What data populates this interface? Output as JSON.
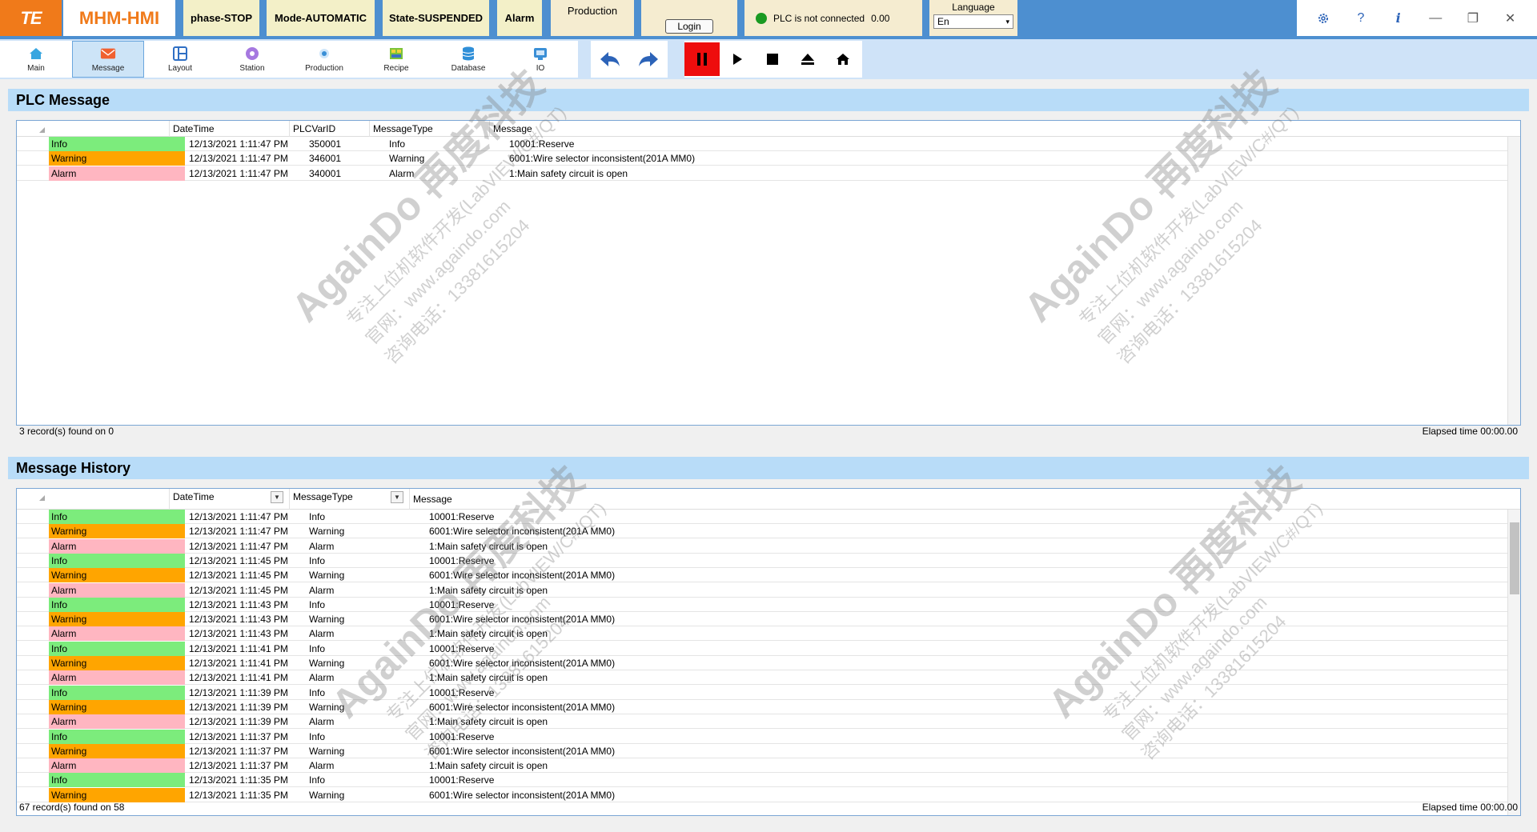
{
  "titlebar": {
    "logo": "TE",
    "app_title": "MHM-HMI",
    "phase": "phase-STOP",
    "mode": "Mode-AUTOMATIC",
    "state": "State-SUSPENDED",
    "alarm": "Alarm",
    "production": "Production",
    "login": "Login",
    "plc_status": "PLC is not connected",
    "plc_value": "0.00",
    "language_label": "Language",
    "language_value": "En"
  },
  "toolbar": {
    "nav": [
      {
        "label": "Main",
        "icon": "home-icon"
      },
      {
        "label": "Message",
        "icon": "mail-icon"
      },
      {
        "label": "Layout",
        "icon": "layout-icon"
      },
      {
        "label": "Station",
        "icon": "station-icon"
      },
      {
        "label": "Production",
        "icon": "production-icon"
      },
      {
        "label": "Recipe",
        "icon": "recipe-icon"
      },
      {
        "label": "Database",
        "icon": "database-icon"
      },
      {
        "label": "IO",
        "icon": "io-icon"
      }
    ],
    "active_tab": "Message"
  },
  "colors": {
    "accent": "#4d8fd0",
    "info": "#7cec7c",
    "warning": "#ffa500",
    "alarm": "#ffb6c1",
    "pause": "#ee0d0d",
    "logo": "#f07a1a"
  },
  "plc_message": {
    "title": "PLC Message",
    "columns": [
      "DateTime",
      "PLCVarID",
      "MessageType",
      "Message"
    ],
    "rows": [
      {
        "type": "Info",
        "datetime": "12/13/2021 1:11:47 PM",
        "varid": "350001",
        "mtype": "Info",
        "message": "10001:Reserve"
      },
      {
        "type": "Warning",
        "datetime": "12/13/2021 1:11:47 PM",
        "varid": "346001",
        "mtype": "Warning",
        "message": "6001:Wire selector inconsistent(201A MM0)"
      },
      {
        "type": "Alarm",
        "datetime": "12/13/2021 1:11:47 PM",
        "varid": "340001",
        "mtype": "Alarm",
        "message": "1:Main safety circuit is open"
      }
    ],
    "footer_left": "3 record(s) found on 0",
    "footer_right": "Elapsed time 00:00.00"
  },
  "message_history": {
    "title": "Message History",
    "columns": [
      "DateTime",
      "MessageType",
      "Message"
    ],
    "rows": [
      {
        "type": "Info",
        "datetime": "12/13/2021 1:11:47 PM",
        "mtype": "Info",
        "message": "10001:Reserve"
      },
      {
        "type": "Warning",
        "datetime": "12/13/2021 1:11:47 PM",
        "mtype": "Warning",
        "message": "6001:Wire selector inconsistent(201A MM0)"
      },
      {
        "type": "Alarm",
        "datetime": "12/13/2021 1:11:47 PM",
        "mtype": "Alarm",
        "message": "1:Main safety circuit is open"
      },
      {
        "type": "Info",
        "datetime": "12/13/2021 1:11:45 PM",
        "mtype": "Info",
        "message": "10001:Reserve"
      },
      {
        "type": "Warning",
        "datetime": "12/13/2021 1:11:45 PM",
        "mtype": "Warning",
        "message": "6001:Wire selector inconsistent(201A MM0)"
      },
      {
        "type": "Alarm",
        "datetime": "12/13/2021 1:11:45 PM",
        "mtype": "Alarm",
        "message": "1:Main safety circuit is open"
      },
      {
        "type": "Info",
        "datetime": "12/13/2021 1:11:43 PM",
        "mtype": "Info",
        "message": "10001:Reserve"
      },
      {
        "type": "Warning",
        "datetime": "12/13/2021 1:11:43 PM",
        "mtype": "Warning",
        "message": "6001:Wire selector inconsistent(201A MM0)"
      },
      {
        "type": "Alarm",
        "datetime": "12/13/2021 1:11:43 PM",
        "mtype": "Alarm",
        "message": "1:Main safety circuit is open"
      },
      {
        "type": "Info",
        "datetime": "12/13/2021 1:11:41 PM",
        "mtype": "Info",
        "message": "10001:Reserve"
      },
      {
        "type": "Warning",
        "datetime": "12/13/2021 1:11:41 PM",
        "mtype": "Warning",
        "message": "6001:Wire selector inconsistent(201A MM0)"
      },
      {
        "type": "Alarm",
        "datetime": "12/13/2021 1:11:41 PM",
        "mtype": "Alarm",
        "message": "1:Main safety circuit is open"
      },
      {
        "type": "Info",
        "datetime": "12/13/2021 1:11:39 PM",
        "mtype": "Info",
        "message": "10001:Reserve"
      },
      {
        "type": "Warning",
        "datetime": "12/13/2021 1:11:39 PM",
        "mtype": "Warning",
        "message": "6001:Wire selector inconsistent(201A MM0)"
      },
      {
        "type": "Alarm",
        "datetime": "12/13/2021 1:11:39 PM",
        "mtype": "Alarm",
        "message": "1:Main safety circuit is open"
      },
      {
        "type": "Info",
        "datetime": "12/13/2021 1:11:37 PM",
        "mtype": "Info",
        "message": "10001:Reserve"
      },
      {
        "type": "Warning",
        "datetime": "12/13/2021 1:11:37 PM",
        "mtype": "Warning",
        "message": "6001:Wire selector inconsistent(201A MM0)"
      },
      {
        "type": "Alarm",
        "datetime": "12/13/2021 1:11:37 PM",
        "mtype": "Alarm",
        "message": "1:Main safety circuit is open"
      },
      {
        "type": "Info",
        "datetime": "12/13/2021 1:11:35 PM",
        "mtype": "Info",
        "message": "10001:Reserve"
      },
      {
        "type": "Warning",
        "datetime": "12/13/2021 1:11:35 PM",
        "mtype": "Warning",
        "message": "6001:Wire selector inconsistent(201A MM0)"
      }
    ],
    "footer_left": "67 record(s) found on 58",
    "footer_right": "Elapsed time 00:00.00"
  },
  "watermark": {
    "brand": "AgainDo 再度科技",
    "line1": "专注上位机软件开发(LabVIEW/C#/QT)",
    "line2": "官网：www.againdo.com",
    "line3": "咨询电话：13381615204"
  }
}
